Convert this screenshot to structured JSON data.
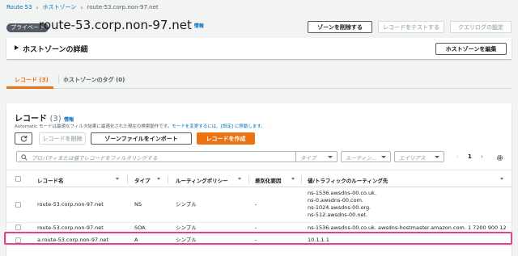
{
  "breadcrumb": {
    "items": [
      "Route 53",
      "ホストゾーン"
    ],
    "current": "route-53.corp.non-97.net"
  },
  "header": {
    "badge": "プライベート",
    "title": "route-53.corp.non-97.net",
    "info": "情報",
    "buttons": {
      "delete_zone": "ゾーンを削除する",
      "test_record": "レコードをテストする",
      "query_logging": "クエリログの設定"
    }
  },
  "details": {
    "label": "ホストゾーンの詳細",
    "edit_button": "ホストゾーンを編集"
  },
  "tabs": [
    {
      "label": "レコード (3)",
      "active": true
    },
    {
      "label": "ホストゾーンのタグ (0)",
      "active": false
    }
  ],
  "records": {
    "title": "レコード",
    "count": "(3)",
    "info": "情報",
    "description": {
      "prefix": "Automatic モードは最適なフィルタ結果に最適化された現在の検索動作です。",
      "link": "モードを変更するには、[設定] に移動します。"
    },
    "buttons": {
      "delete": "レコードを削除",
      "import": "ゾーンファイルをインポート",
      "create": "レコードを作成"
    },
    "search_placeholder": "プロパティまたは値でレコードをフィルタリングする",
    "filters": {
      "type": "タイプ",
      "routing": "ルーティン...",
      "alias": "エイリアス"
    },
    "pagination": {
      "page": "1"
    },
    "columns": [
      "レコード名",
      "タイプ",
      "ルーティングポリシー",
      "差別化要因",
      "値/トラフィックのルーティング先"
    ],
    "rows": [
      {
        "name": "route-53.corp.non-97.net",
        "type": "NS",
        "policy": "シンプル",
        "diff": "-",
        "values": [
          "ns-1536.awsdns-00.co.uk.",
          "ns-0.awsdns-00.com.",
          "ns-1024.awsdns-00.org.",
          "ns-512.awsdns-00.net."
        ]
      },
      {
        "name": "route-53.corp.non-97.net",
        "type": "SOA",
        "policy": "シンプル",
        "diff": "-",
        "values": [
          "ns-1536.awsdns-00.co.uk. awsdns-hostmaster.amazon.com. 1 7200 900 12"
        ]
      },
      {
        "name": "a.route-53.corp.non-97.net",
        "type": "A",
        "policy": "シンプル",
        "diff": "-",
        "values": [
          "10.1.1.1"
        ]
      }
    ]
  },
  "colors": {
    "accent": "#ec7211",
    "link": "#0073bb",
    "highlight": "#e83e8c"
  }
}
